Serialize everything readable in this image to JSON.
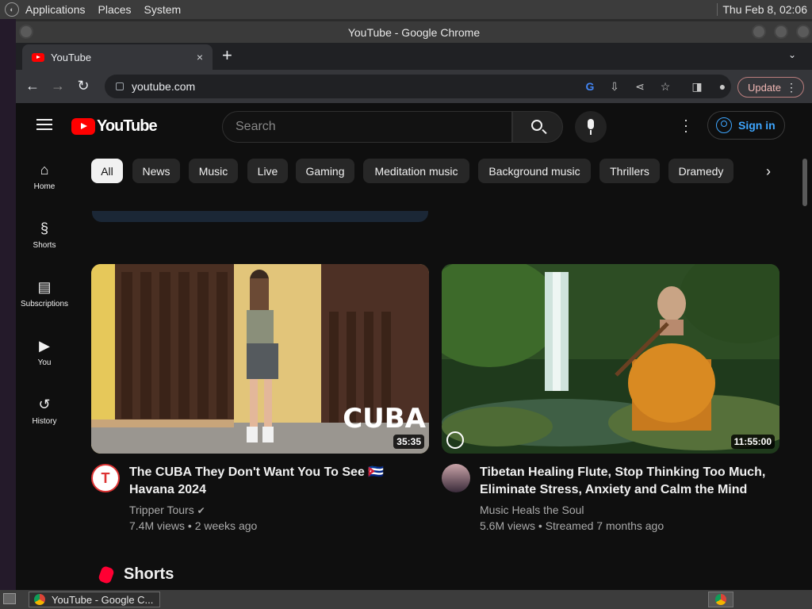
{
  "desktop": {
    "menus": [
      "Applications",
      "Places",
      "System"
    ],
    "clock": "Thu Feb  8, 02:06",
    "taskbar_item": "YouTube - Google C..."
  },
  "window": {
    "title": "YouTube - Google Chrome"
  },
  "browser": {
    "tab_title": "YouTube",
    "tab_close": "×",
    "new_tab": "+",
    "tab_menu": "⌄",
    "url": "youtube.com",
    "update_label": "Update"
  },
  "youtube": {
    "logo_text": "YouTube",
    "search_placeholder": "Search",
    "signin_label": "Sign in",
    "sidebar": [
      {
        "label": "Home",
        "icon": "home-icon"
      },
      {
        "label": "Shorts",
        "icon": "shorts-icon"
      },
      {
        "label": "Subscriptions",
        "icon": "subscriptions-icon"
      },
      {
        "label": "You",
        "icon": "you-icon"
      },
      {
        "label": "History",
        "icon": "history-icon"
      }
    ],
    "chips": [
      "All",
      "News",
      "Music",
      "Live",
      "Gaming",
      "Meditation music",
      "Background music",
      "Thrillers",
      "Dramedy"
    ],
    "videos": [
      {
        "title": "The CUBA They Don't Want You To See 🇨🇺 Havana 2024",
        "channel": "Tripper Tours",
        "meta": "7.4M views • 2 weeks ago",
        "duration": "35:35",
        "thumb_text": "CUBA"
      },
      {
        "title": "Tibetan Healing Flute, Stop Thinking Too Much, Eliminate Stress, Anxiety and Calm the Mind",
        "channel": "Music Heals the Soul",
        "meta": "5.6M views • Streamed 7 months ago",
        "duration": "11:55:00"
      }
    ],
    "shorts_heading": "Shorts"
  }
}
